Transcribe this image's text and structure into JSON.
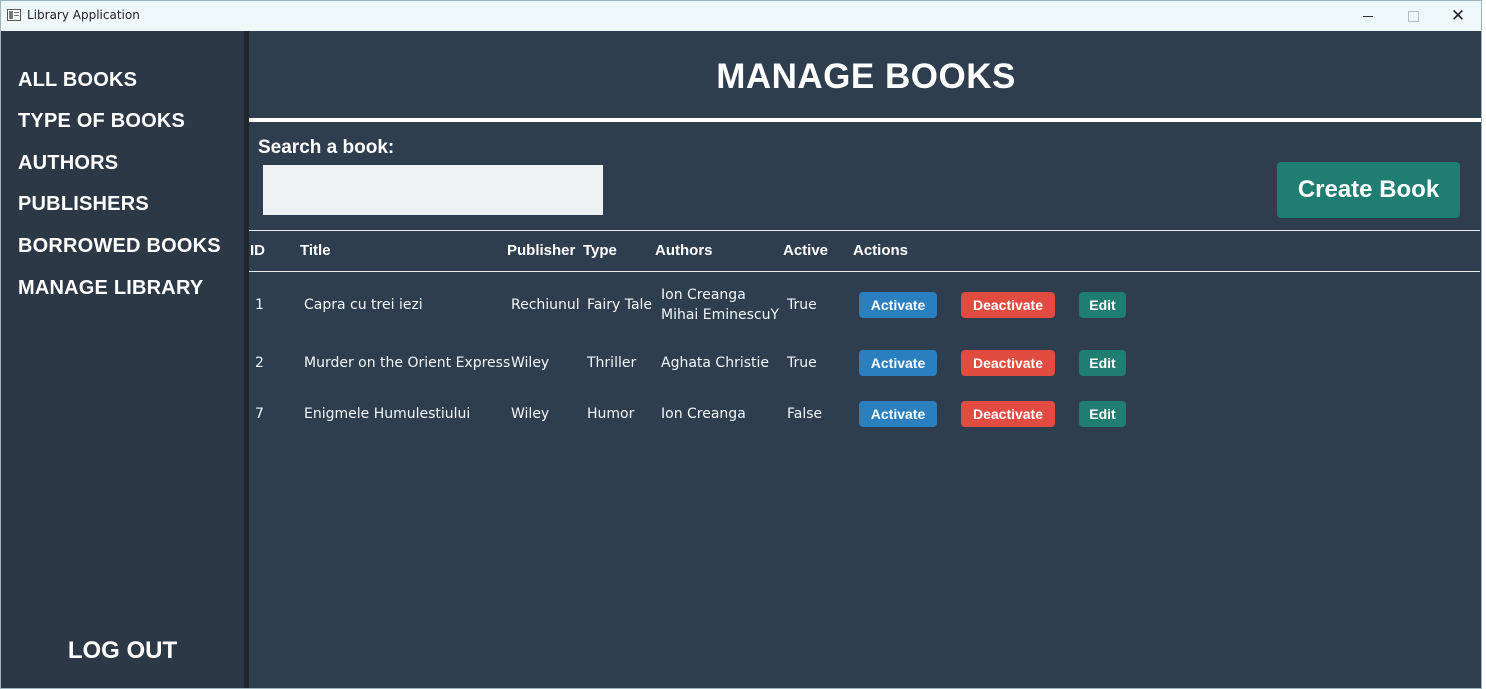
{
  "window": {
    "title": "Library Application",
    "close_glyph": "✕"
  },
  "sidebar": {
    "items": [
      {
        "label": "ALL BOOKS"
      },
      {
        "label": "TYPE OF BOOKS"
      },
      {
        "label": "AUTHORS"
      },
      {
        "label": "PUBLISHERS"
      },
      {
        "label": "BORROWED BOOKS"
      },
      {
        "label": "MANAGE LIBRARY"
      }
    ],
    "logout_label": "LOG OUT"
  },
  "main": {
    "title": "MANAGE BOOKS",
    "search_label": "Search a book:",
    "search_value": "",
    "create_button": "Create Book"
  },
  "table": {
    "headers": [
      "ID",
      "Title",
      "Publisher",
      "Type",
      "Authors",
      "Active",
      "Actions"
    ],
    "rows": [
      {
        "id": "1",
        "title": "Capra cu trei iezi",
        "publisher": "Rechiunul",
        "type": "Fairy Tale",
        "authors": [
          "Ion Creanga",
          "Mihai EminescuY"
        ],
        "active": "True"
      },
      {
        "id": "2",
        "title": "Murder on the Orient Express",
        "publisher": "Wiley",
        "type": "Thriller",
        "authors": [
          "Aghata Christie"
        ],
        "active": "True"
      },
      {
        "id": "7",
        "title": "Enigmele Humulestiului",
        "publisher": "Wiley",
        "type": "Humor",
        "authors": [
          "Ion Creanga"
        ],
        "active": "False"
      }
    ],
    "action_labels": {
      "activate": "Activate",
      "deactivate": "Deactivate",
      "edit": "Edit"
    }
  },
  "colors": {
    "sidebar_bg": "#2c3846",
    "main_bg": "#2f3e4f",
    "create_button_bg": "#207d72",
    "activate_bg": "#2a7fbe",
    "deactivate_bg": "#e24b3f",
    "edit_bg": "#1f7d72"
  }
}
